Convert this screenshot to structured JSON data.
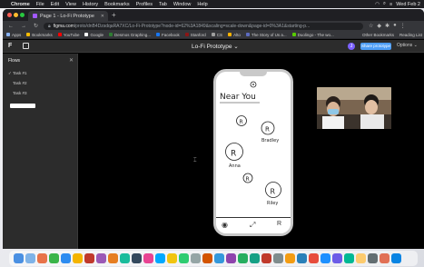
{
  "menubar": {
    "app": "Chrome",
    "menus": [
      "File",
      "Edit",
      "View",
      "History",
      "Bookmarks",
      "Profiles",
      "Tab",
      "Window",
      "Help"
    ],
    "clock": "Wed Feb 2"
  },
  "browser": {
    "tab_title": "Page 1 - Lo-Fi Prototype",
    "url_host": "figma.com",
    "url_path": "/proto/dnB4DzsdqaRA7XC/Lo-Fi-Prototype?node-id=62%3A1849&scaling=scale-down&page-id=0%3A1&starting-p...",
    "bookmarks": [
      {
        "label": "Apps",
        "color": "#8ab4f8"
      },
      {
        "label": "Bookmarks",
        "color": "#fbbc04"
      },
      {
        "label": "YouTube",
        "color": "#ff0000"
      },
      {
        "label": "Google",
        "color": "#ffffff"
      },
      {
        "label": "Desmos Graphing...",
        "color": "#2e7d32"
      },
      {
        "label": "Facebook",
        "color": "#1877f2"
      },
      {
        "label": "Stanford",
        "color": "#8c1515"
      },
      {
        "label": "CS",
        "color": "#9e9e9e"
      },
      {
        "label": "Alto",
        "color": "#ffb300"
      },
      {
        "label": "The Story of Us a...",
        "color": "#5c6bc0"
      },
      {
        "label": "Duolingo - The wo...",
        "color": "#58cc02"
      }
    ],
    "bookmarks_right": [
      "Other Bookmarks",
      "Reading List"
    ]
  },
  "figma": {
    "prototype_name": "Lo-Fi Prototype",
    "share_label": "Share prototype",
    "options_label": "Options",
    "avatar_letter": "J",
    "flows_header": "Flows",
    "flows": [
      "Task #1",
      "Task #2",
      "Task #3"
    ]
  },
  "mockup": {
    "title": "Near You",
    "people": [
      {
        "initial": "R",
        "name": ""
      },
      {
        "initial": "R",
        "name": "Bradley"
      },
      {
        "initial": "R",
        "name": "Anna"
      },
      {
        "initial": "R",
        "name": ""
      },
      {
        "initial": "R",
        "name": "Riley"
      }
    ],
    "nav_icons": [
      "camera-icon",
      "arrows-icon",
      "profile-icon"
    ],
    "nav_right_letter": "R"
  },
  "dock": {
    "colors": [
      "#4a90e2",
      "#7fb3e8",
      "#e8734a",
      "#3bb54a",
      "#2d8cf0",
      "#f4b400",
      "#c0392b",
      "#9b59b6",
      "#e67e22",
      "#1abc9c",
      "#34495e",
      "#e84393",
      "#00a8ff",
      "#f1c40f",
      "#2ecc71",
      "#95a5a6",
      "#d35400",
      "#3498db",
      "#8e44ad",
      "#27ae60",
      "#16a085",
      "#c0392b",
      "#7f8c8d",
      "#f39c12",
      "#2980b9",
      "#e74c3c",
      "#1e90ff",
      "#6c5ce7",
      "#00b894",
      "#fdcb6e",
      "#636e72",
      "#e17055",
      "#0984e3"
    ]
  }
}
